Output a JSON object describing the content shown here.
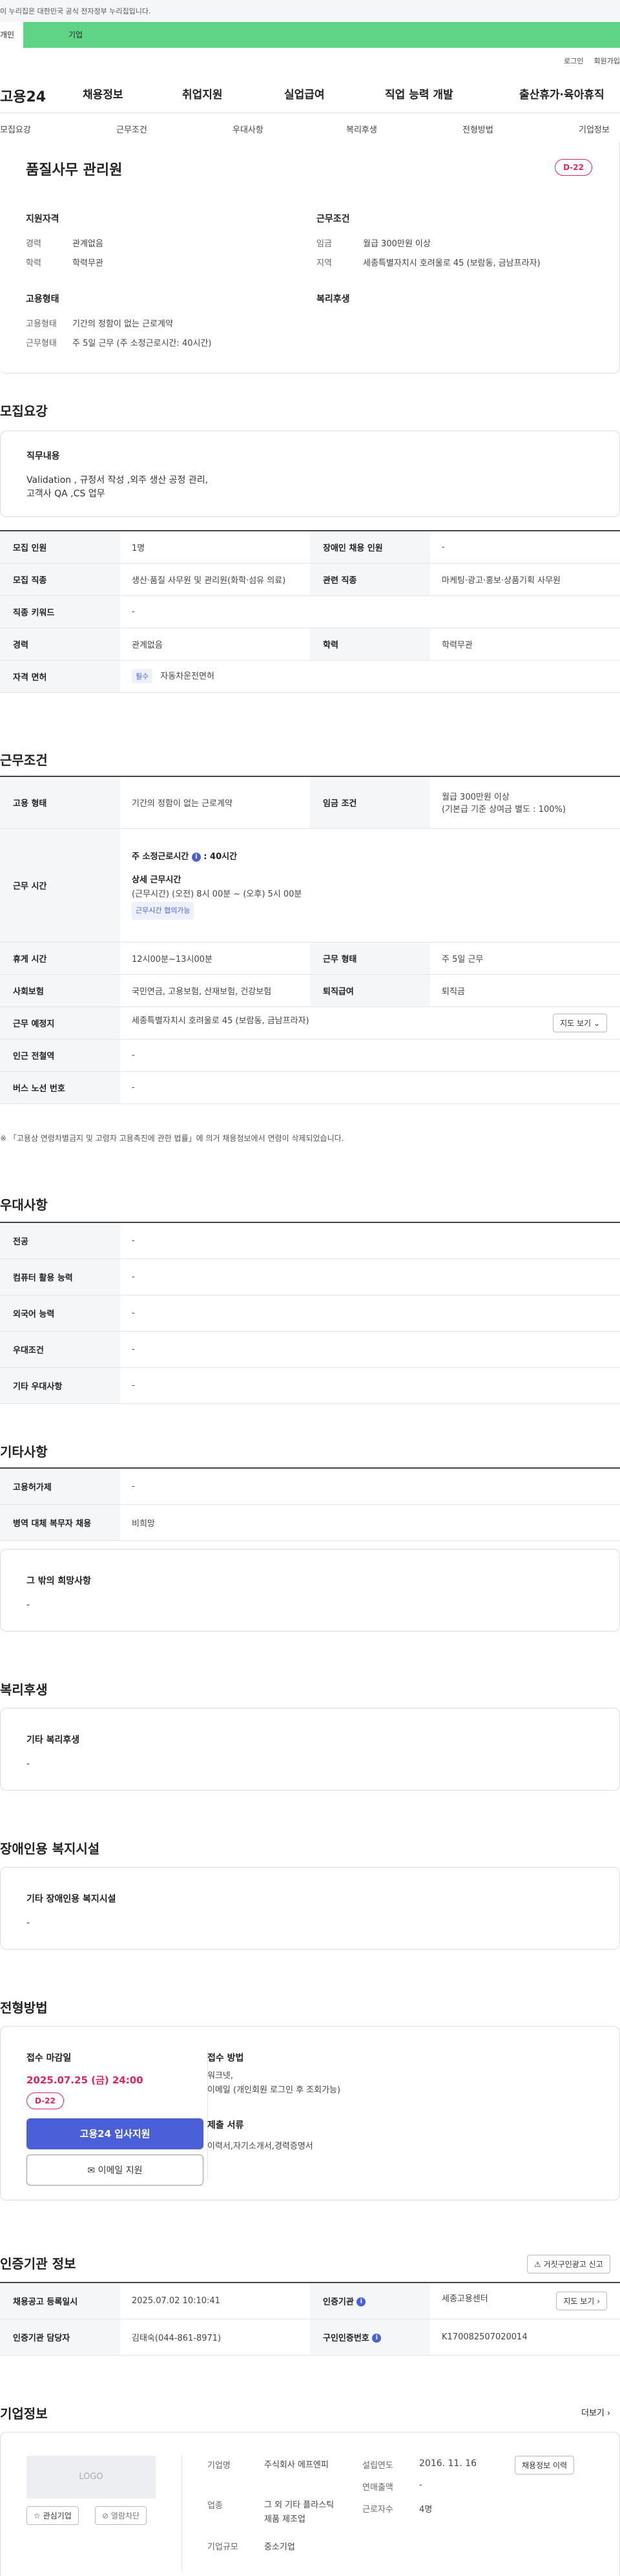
{
  "gov_banner": "이 누리집은 대한민국 공식 전자정부 누리집입니다.",
  "tabs": {
    "individual": "개인",
    "company": "기업"
  },
  "util": {
    "login": "로그인",
    "join": "회원가입"
  },
  "logo": "고용24",
  "gnb": [
    "채용정보",
    "취업지원",
    "실업급여",
    "직업 능력 개발",
    "출산휴가·육아휴직"
  ],
  "subnav": [
    "모집요강",
    "근무조건",
    "우대사항",
    "복리후생",
    "전형방법",
    "기업정보"
  ],
  "job": {
    "title": "품질사무 관리원",
    "dday": "D-22",
    "qual_heading": "지원자격",
    "cond_heading": "근무조건",
    "type_heading": "고용형태",
    "welfare_heading": "복리후생",
    "career_label": "경력",
    "career": "관계없음",
    "edu_label": "학력",
    "edu": "학력무관",
    "wage_label": "임금",
    "wage": "월급 300만원 이상",
    "region_label": "지역",
    "region": "세종특별자치시 호려울로 45 (보람동, 금남프라자)",
    "emptype_label": "고용형태",
    "emptype": "기간의 정함이 없는 근로계약",
    "worktype_label": "근무형태",
    "worktype": "주 5일 근무 (주 소정근로시간: 40시간)"
  },
  "recruit": {
    "heading": "모집요강",
    "duty_title": "직무내용",
    "duty_text": "Validation , 규정서 작성 ,외주 생산 공정 관리,\n고객사 QA ,CS 업무",
    "rows": {
      "count_label": "모집 인원",
      "count": "1명",
      "disabled_label": "장애인 채용 인원",
      "disabled": "-",
      "job_label": "모집 직종",
      "job": "생산·품질 사무원 및 관리원(화학·섬유 의료)",
      "related_label": "관련 직종",
      "related": "마케팅·광고·홍보·상품기획 사무원",
      "keyword_label": "직종 키워드",
      "keyword": "-",
      "career_label": "경력",
      "career": "관계없음",
      "edu_label": "학력",
      "edu": "학력무관",
      "license_label": "자격 면허",
      "license_tag": "필수",
      "license": "자동차운전면허"
    }
  },
  "conditions": {
    "heading": "근무조건",
    "emptype_label": "고용 형태",
    "emptype": "기간의 정함이 없는 근로계약",
    "wage_label": "임금 조건",
    "wage": "월급 300만원 이상",
    "wage_note": "(기본급 기준 상여금 별도 : 100%)",
    "hours_label": "근무 시간",
    "weekly_label": "주 소정근로시간",
    "weekly": "40시간",
    "detail_label": "상세 근무시간",
    "detail": "(근무시간) (오전) 8시 00분 ~ (오후) 5시 00분",
    "consult_tag": "근무시간 협의가능",
    "break_label": "휴게 시간",
    "break": "12시00분~13시00분",
    "worktype_label": "근무 형태",
    "worktype": "주 5일 근무",
    "insurance_label": "사회보험",
    "insurance": "국민연금, 고용보험, 산재보험, 건강보험",
    "severance_label": "퇴직급여",
    "severance": "퇴직금",
    "place_label": "근무 예정지",
    "place": "세종특별자치시 호려울로 45 (보람동, 금남프라자)",
    "map_button": "지도 보기",
    "subway_label": "인근 전철역",
    "subway": "-",
    "bus_label": "버스 노선 번호",
    "bus": "-",
    "footnote": "※ 「고용상 연령차별금지 및 고령자 고용촉진에 관한 법률」에 의거 채용정보에서 연령이 삭제되었습니다."
  },
  "preference": {
    "heading": "우대사항",
    "rows": [
      {
        "label": "전공",
        "value": "-"
      },
      {
        "label": "컴퓨터 활용 능력",
        "value": "-"
      },
      {
        "label": "외국어 능력",
        "value": "-"
      },
      {
        "label": "우대조건",
        "value": "-"
      },
      {
        "label": "기타 우대사항",
        "value": "-"
      }
    ]
  },
  "etc": {
    "heading": "기타사항",
    "rows": [
      {
        "label": "고용허가제",
        "value": "-"
      },
      {
        "label": "병역 대체 복무자 채용",
        "value": "비희망"
      }
    ],
    "other_title": "그 밖의 희망사항",
    "other_value": "-"
  },
  "welfare": {
    "heading": "복리후생",
    "title": "기타 복리후생",
    "value": "-"
  },
  "disabled_fac": {
    "heading": "장애인용 복지시설",
    "title": "기타 장애인용 복지시설",
    "value": "-"
  },
  "selection": {
    "heading": "전형방법",
    "deadline_title": "접수 마감일",
    "deadline": "2025.07.25 (금) 24:00",
    "dday": "D-22",
    "apply_button": "고용24 입사지원",
    "email_button": "이메일 지원",
    "method_title": "접수 방법",
    "method": "워크넷,\n이메일 (개인회원 로그인 후 조회가능)",
    "docs_title": "제출 서류",
    "docs": "이력서,자기소개서,경력증명서"
  },
  "agency": {
    "heading": "인증기관 정보",
    "report_button": "거짓구인광고 신고",
    "reg_label": "채용공고 등록일시",
    "reg": "2025.07.02 10:10:41",
    "org_label": "인증기관",
    "org": "세종고용센터",
    "map_button": "지도 보기",
    "manager_label": "인증기관 담당자",
    "manager": "김태숙(044-861-8971)",
    "number_label": "구인인증번호",
    "number": "K170082507020014"
  },
  "company": {
    "heading": "기업정보",
    "more": "더보기",
    "logo_text": "LOGO",
    "interest_button": "관심기업",
    "block_button": "열람차단",
    "name_label": "기업명",
    "name": "주식회사 에프엔피",
    "industry_label": "업종",
    "industry": "그 외 기타 플라스틱 제품 제조업",
    "size_label": "기업규모",
    "size": "중소기업",
    "founded_label": "설립연도",
    "founded": "2016. 11. 16",
    "sales_label": "연매출액",
    "sales": "-",
    "employees_label": "근로자수",
    "employees": "4명",
    "listing_button": "채용정보 이력"
  }
}
